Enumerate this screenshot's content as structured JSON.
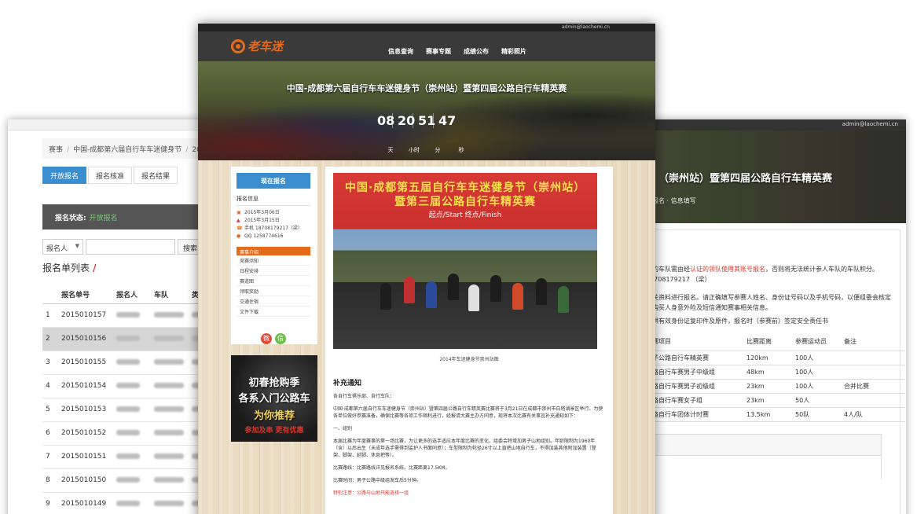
{
  "left_window": {
    "breadcrumb": [
      "赛事",
      "中国-成都第六届自行车车迷健身节",
      "2015年"
    ],
    "tabs": [
      "开放报名",
      "报名核准",
      "报名结果"
    ],
    "status_label": "报名状态:",
    "status_value": "开放报名",
    "search": {
      "select_value": "报名人",
      "button": "搜索"
    },
    "list_title": "报名单列表",
    "columns": [
      "报名单号",
      "报名人",
      "车队",
      "类型"
    ],
    "rows": [
      {
        "index": "1",
        "id": "2015010157"
      },
      {
        "index": "2",
        "id": "2015010156"
      },
      {
        "index": "3",
        "id": "2015010155"
      },
      {
        "index": "4",
        "id": "2015010154"
      },
      {
        "index": "5",
        "id": "2015010153"
      },
      {
        "index": "6",
        "id": "2015010152"
      },
      {
        "index": "7",
        "id": "2015010151"
      },
      {
        "index": "8",
        "id": "2015010150"
      },
      {
        "index": "9",
        "id": "2015010149"
      }
    ]
  },
  "right_window": {
    "admin_email": "admin@laochemi.cn",
    "hero_title": "（崇州站）暨第四届公路自行车精英赛",
    "hero_sub": "报名 · 信息填写",
    "notice": {
      "line1_a": "事的车队需由经",
      "line1_red": "认证的领队使用其账号报名",
      "line1_b": "，否则将无法统计参人车队的车队积分。",
      "line2": "18708179217 （梁）",
      "line3": "相关资料进行报名。请正确填写参赛人姓名、身份证号码以及手机号码，以便组委会核定",
      "line4": "一购买人身意外险及短信通知赛事相关信息。",
      "line5": "提供有效身份证复印件及原件，报名时（参赛前）签定安全责任书"
    },
    "table": {
      "columns": [
        "比赛项目",
        "比赛距离",
        "参赛运动员",
        "备注"
      ],
      "rows": [
        [
          "男子公路自行车精英赛",
          "120km",
          "100人",
          ""
        ],
        [
          "公路自行车赛男子中级组",
          "48km",
          "100人",
          ""
        ],
        [
          "公路自行车赛男子初级组",
          "23km",
          "100人",
          "合并比赛"
        ],
        [
          "公路自行车赛女子组",
          "23km",
          "50人",
          ""
        ],
        [
          "公路自行车团体计时赛",
          "13.5km",
          "50队",
          "4人/队"
        ]
      ]
    }
  },
  "center_window": {
    "admin_email": "admin@laochemi.cn",
    "logo_text": "老车迷",
    "nav": [
      "信息查询",
      "赛事专题",
      "成绩公布",
      "精彩照片"
    ],
    "hero_title": "中国-成都第六届自行车车迷健身节（崇州站）暨第四届公路自行车精英赛",
    "countdown": {
      "days": "08",
      "hours": "20",
      "minutes": "51",
      "seconds": "47"
    },
    "countdown_units": [
      "天",
      "小时",
      "分",
      "秒"
    ],
    "signup_button": "现在报名",
    "side_heading": "报名信息",
    "info_lines": [
      "2015年3月06日",
      "2015年3月15日",
      "手机 18708179217（梁）",
      "QQ 1258774616"
    ],
    "subnav_head": "赛事介绍",
    "subnav_items": [
      "竞赛须知",
      "日程安排",
      "赛道图",
      "领取奖励",
      "交通住宿",
      "文件下载"
    ],
    "social": {
      "weibo_glyph": "微",
      "wechat_glyph": "信"
    },
    "ad": {
      "line1": "初春抢购季",
      "line2": "各系入门公路车",
      "line3": "为你推荐",
      "line4": "参加及串 更有优惠"
    },
    "photo": {
      "banner1": "中国·成都第五届自行车车迷健身节（崇州站）",
      "banner2": "暨第三届公路自行车精英赛",
      "banner3": "起点/Start    终点/Finish"
    },
    "caption": "2014年车迷健身节崇州站图",
    "section_title": "补充通知",
    "paragraphs": [
      "各自行车俱乐部、自行车队：",
      "中国·成都第六届自行车车迷健身节（崇州站）暨第四届公路自行车精英赛比赛将于3月21日在成都市崇州市白塔湖景区举行。为使各单位做好参赛准备，确保比赛等各项工作顺利进行，经报请大赛主办方同意，现将本次比赛有关事宜补充通知如下：",
      "一、组别",
      "本届比赛为年度赛事的第一场比赛，为让更多的选手适应本年度比赛的变化，组委会特增加男子山地组别。年龄限制为1960年（含）以后出生（未成年选手需得到监护人书面同意）；车型限制为轮径26寸以上直把山地自行车，不得加装其他附加装置（登架、脚架、延脚、休息把等）。",
      "比赛路线：比赛路线详见报名系统。比赛距离17.5KM。",
      "比赛时间：男子公路中级组发车后5分钟。"
    ],
    "red_note": "特别注意：公路与山地只能选择一组",
    "colors": {
      "orange": "#e66a1a",
      "blue": "#3a8ecf",
      "red": "#d9342b"
    }
  }
}
